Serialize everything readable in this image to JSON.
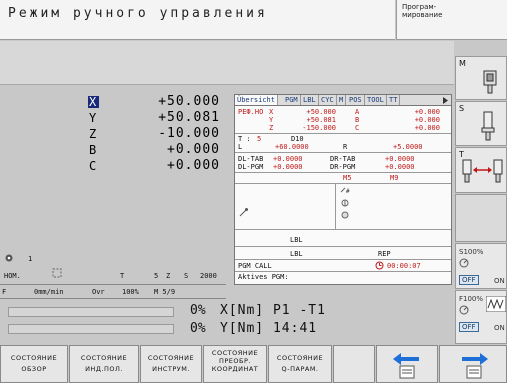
{
  "header": {
    "title": "Режим ручного управления",
    "mode_line1": "Програм-",
    "mode_line2": "мирование"
  },
  "axes": [
    {
      "name": "X",
      "value": "+50.000"
    },
    {
      "name": "Y",
      "value": "+50.081"
    },
    {
      "name": "Z",
      "value": "-10.000"
    },
    {
      "name": "B",
      "value": "+0.000"
    },
    {
      "name": "C",
      "value": "+0.000"
    }
  ],
  "tabs": [
    "Übersicht",
    "PGM",
    "LBL",
    "CYC",
    "M",
    "POS",
    "TOOL",
    "TT"
  ],
  "overview": {
    "pos_label": "РЕФ.НО",
    "rows": [
      {
        "ax": "X",
        "val": "+50.000",
        "ax2": "A",
        "val2": "+0.000"
      },
      {
        "ax": "Y",
        "val": "+50.081",
        "ax2": "B",
        "val2": "+0.000"
      },
      {
        "ax": "Z",
        "val": "-150.000",
        "ax2": "C",
        "val2": "+0.000"
      }
    ],
    "t_label": "T :",
    "t_num": "5",
    "t_name": "D10",
    "l_label": "L",
    "l_val": "+60.0000",
    "r_label": "R",
    "r_val": "+5.0000",
    "dl_tab": "DL-TAB",
    "dl_tab_v": "+0.0000",
    "dr_tab": "DR-TAB",
    "dr_tab_v": "+0.0000",
    "dl_pgm": "DL-PGM",
    "dl_pgm_v": "+0.0000",
    "dr_pgm": "DR-PGM",
    "dr_pgm_v": "+0.0000",
    "m5": "M5",
    "m9": "M9",
    "lbl1": "LBL",
    "lbl2": "LBL",
    "rep": "REP",
    "pgm_call": "PGM CALL",
    "timer": "00:00:07",
    "aktives": "Aktives PGM:"
  },
  "status": {
    "tool_num_label": "1",
    "nom_label": "НОМ.",
    "t_label": "T",
    "t_val": "5",
    "z_label": "Z",
    "s_label": "S",
    "s_val": "2000",
    "f_label": "F",
    "f_val": "0mm/min",
    "ovr_label": "Ovr",
    "ovr_val": "100%",
    "m_val": "M 5/9",
    "line1_pct": "0%",
    "line1_text": "X[Nm] P1 -T1",
    "line2_pct": "0%",
    "line2_text": "Y[Nm] 14:41"
  },
  "right_keys": {
    "m_label": "M",
    "s_label": "S",
    "t_label": "T",
    "s100": "S100%",
    "off1": "OFF",
    "on1": "ON",
    "f100": "F100%",
    "off2": "OFF",
    "on2": "ON"
  },
  "softkeys": [
    {
      "line1": "СОСТОЯНИЕ",
      "line2": "ОБЗОР"
    },
    {
      "line1": "СОСТОЯНИЕ",
      "line2": "ИНД.ПОЛ."
    },
    {
      "line1": "СОСТОЯНИЕ",
      "line2": "ИНСТРУМ."
    },
    {
      "line1": "СОСТОЯНИЕ",
      "line2": "ПРЕОБР.",
      "line3": "КООРДИНАТ"
    },
    {
      "line1": "СОСТОЯНИЕ",
      "line2": "Q-ПАРАМ."
    }
  ],
  "colors": {
    "accent": "#1a2a7a",
    "red": "#c01818",
    "arrow": "#1f6fd8"
  }
}
